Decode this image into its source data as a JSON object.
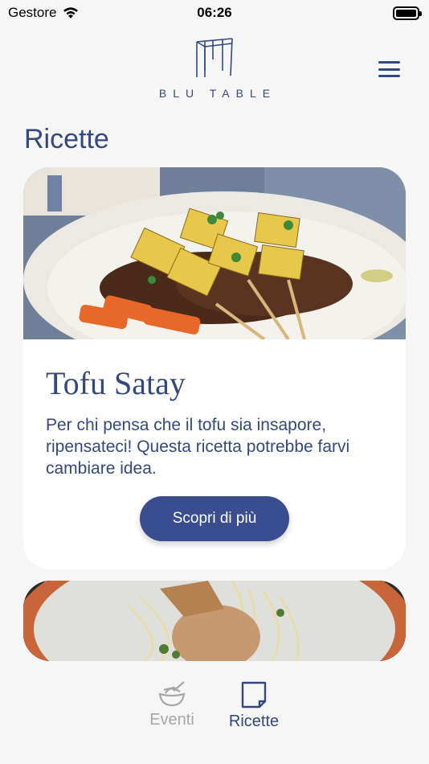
{
  "status_bar": {
    "carrier": "Gestore",
    "time": "06:26"
  },
  "header": {
    "brand": "BLU TABLE"
  },
  "page": {
    "title": "Ricette"
  },
  "recipes": [
    {
      "title": "Tofu Satay",
      "description": "Per chi pensa che il tofu sia insapore, ripensateci! Questa ricetta potrebbe farvi cambiare idea.",
      "cta": "Scopri di più"
    }
  ],
  "tab_bar": {
    "tabs": [
      {
        "label": "Eventi",
        "icon": "bowl-icon",
        "active": false
      },
      {
        "label": "Ricette",
        "icon": "recipe-note-icon",
        "active": true
      }
    ]
  },
  "colors": {
    "brand": "#34487f",
    "button": "#3a4d8f",
    "background": "#f6f6f7",
    "inactive_tab": "#a7a7a7"
  }
}
